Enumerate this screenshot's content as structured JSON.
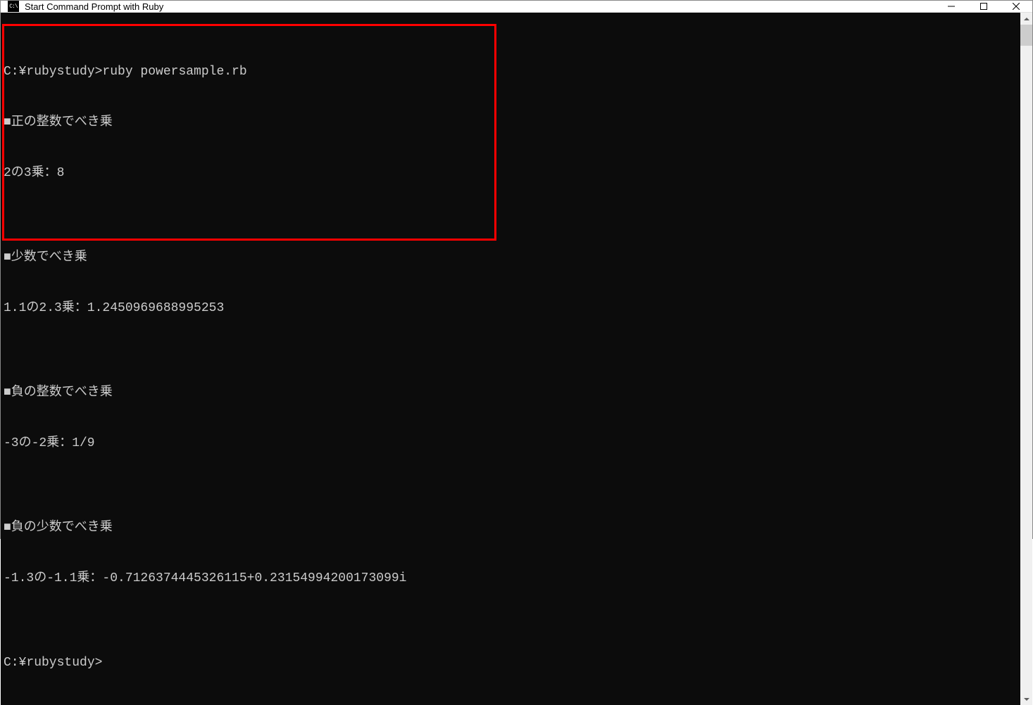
{
  "window": {
    "title": "Start Command Prompt with Ruby",
    "icon_text": "C:\\"
  },
  "terminal": {
    "lines": [
      "C:¥rubystudy>ruby powersample.rb",
      "■正の整数でべき乗",
      "2の3乗：8",
      "",
      "■少数でべき乗",
      "1.1の2.3乗：1.2450969688995253",
      "",
      "■負の整数でべき乗",
      "-3の-2乗：1/9",
      "",
      "■負の少数でべき乗",
      "-1.3の-1.1乗：-0.7126374445326115+0.23154994200173099i",
      "",
      "C:¥rubystudy>"
    ]
  }
}
